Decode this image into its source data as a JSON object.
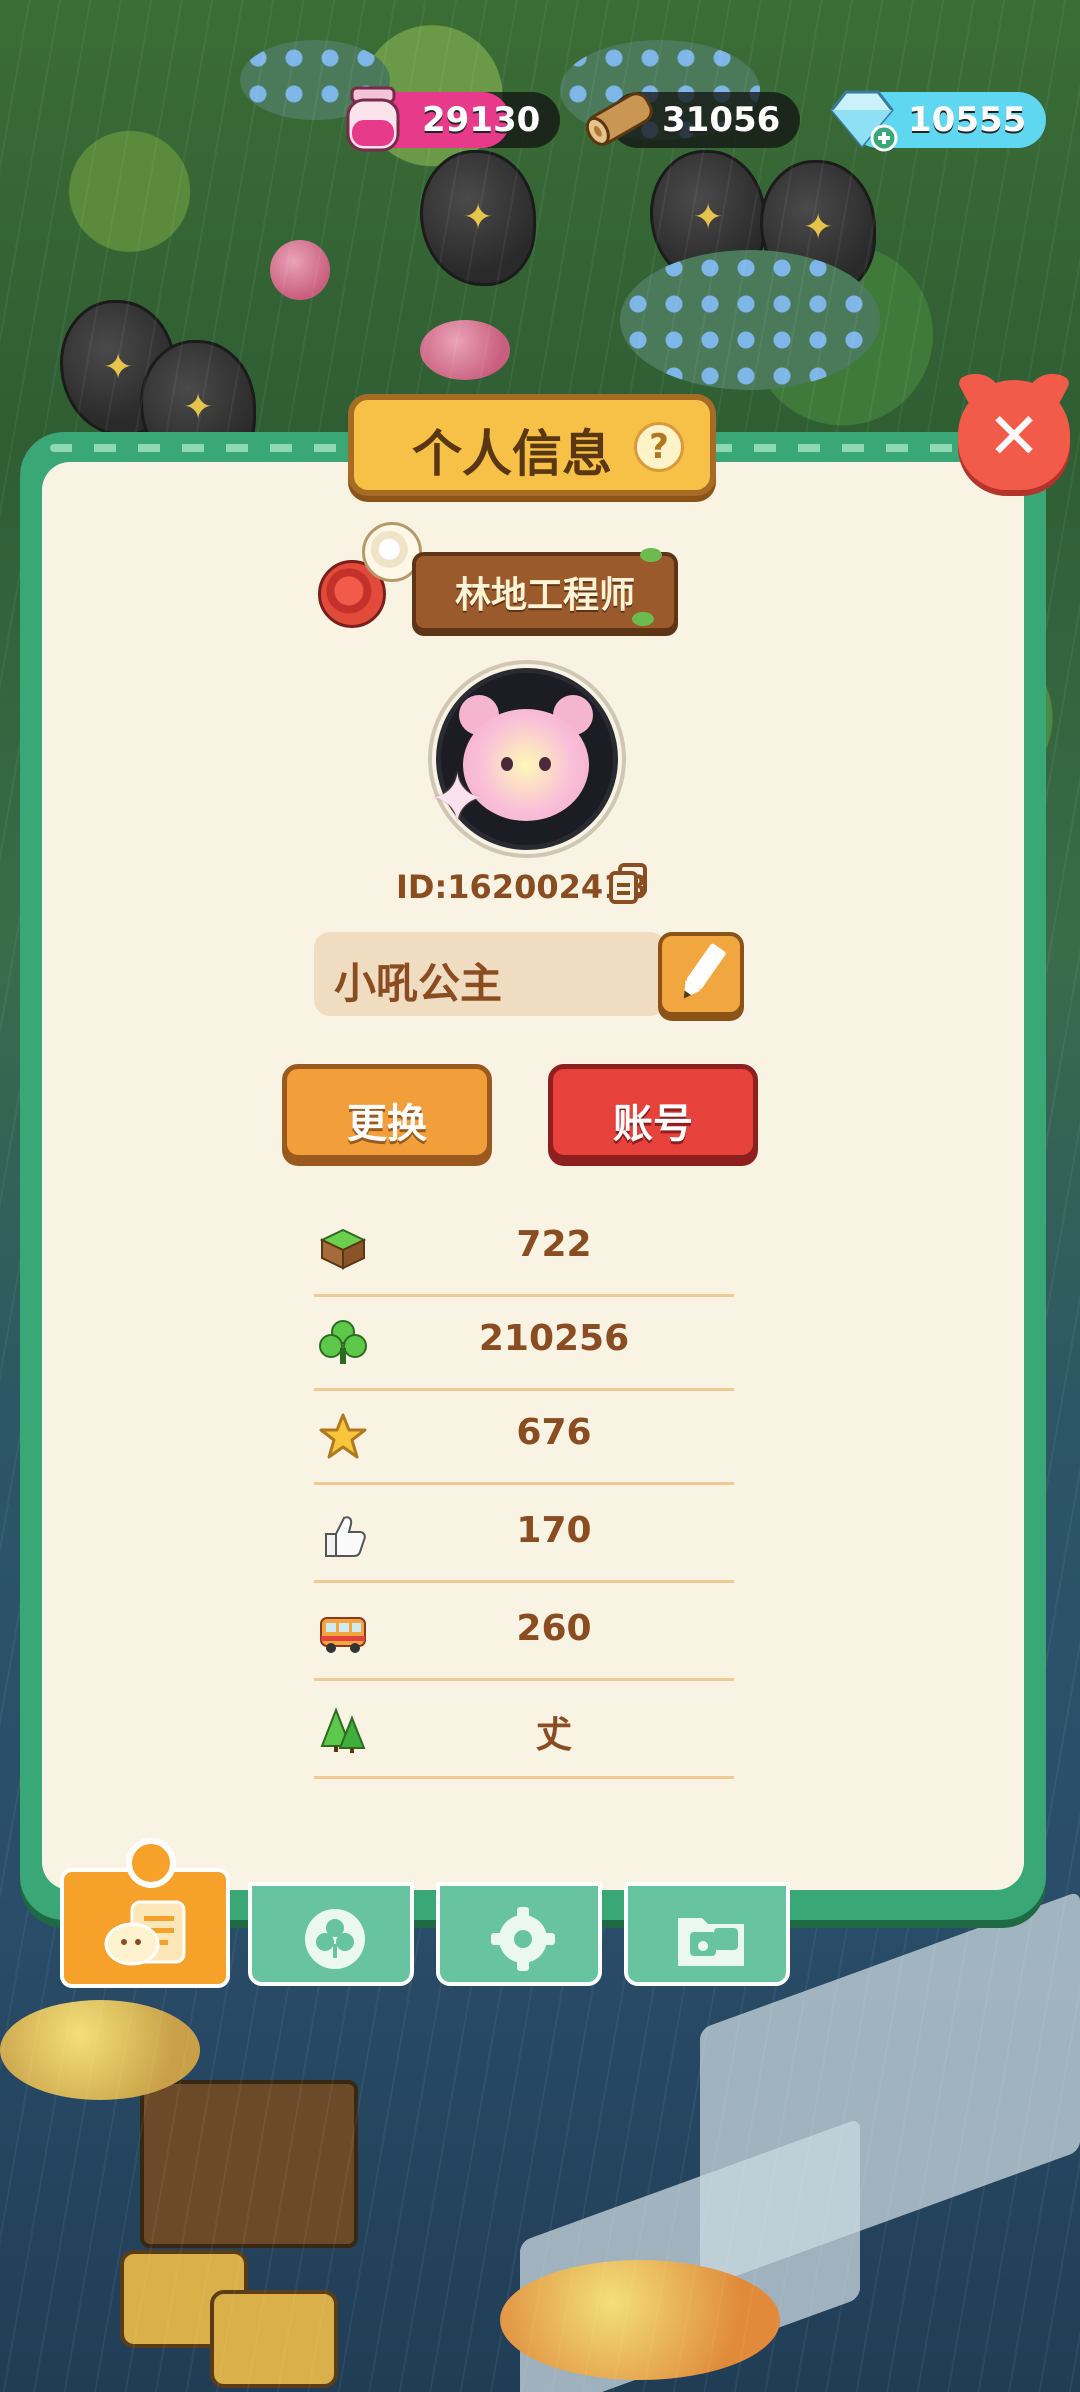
{
  "resources": {
    "potion": {
      "value": "29130",
      "icon": "potion-jar-icon",
      "color": "#e83a8a"
    },
    "wood": {
      "value": "31056",
      "icon": "wood-log-icon",
      "color": "#b07a3a"
    },
    "gems": {
      "value": "10555",
      "icon": "diamond-icon",
      "color": "#5fd7f0"
    }
  },
  "panel": {
    "title": "个人信息",
    "help": "?",
    "close": "✕",
    "badge_title": "林地工程师",
    "id_label": "ID:162002418",
    "name": "小吼公主",
    "change_button": "更换",
    "account_button": "账号"
  },
  "stats": [
    {
      "icon": "grass-block-icon",
      "value": "722"
    },
    {
      "icon": "clover-icon",
      "value": "210256"
    },
    {
      "icon": "star-icon",
      "value": "676"
    },
    {
      "icon": "thumbs-up-icon",
      "value": "170"
    },
    {
      "icon": "bus-icon",
      "value": "260"
    },
    {
      "icon": "pine-trees-icon",
      "value": "𠀋"
    }
  ],
  "tabs": [
    {
      "name": "tab-profile",
      "icon": "profile-card-icon",
      "active": true
    },
    {
      "name": "tab-badges",
      "icon": "clover-badge-icon",
      "active": false
    },
    {
      "name": "tab-settings",
      "icon": "gear-icon",
      "active": false
    },
    {
      "name": "tab-album",
      "icon": "photo-folder-icon",
      "active": false
    }
  ]
}
